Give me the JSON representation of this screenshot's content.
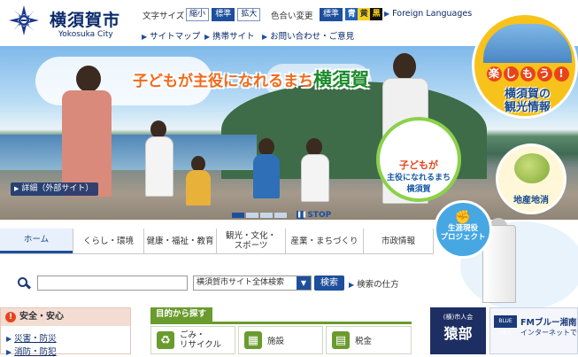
{
  "header": {
    "title_ja": "横須賀市",
    "title_en": "Yokosuka City",
    "font_size_label": "文字サイズ",
    "font_sizes": [
      "縮小",
      "標準",
      "拡大"
    ],
    "color_label": "色合い変更",
    "colors": [
      {
        "label": "標準",
        "bg": "#1e4f9c",
        "fg": "#ffffff"
      },
      {
        "label": "青",
        "bg": "#2060b8",
        "fg": "#ffffff"
      },
      {
        "label": "黄",
        "bg": "#f5d21b",
        "fg": "#333333"
      },
      {
        "label": "黒",
        "bg": "#111111",
        "fg": "#f5d21b"
      }
    ],
    "foreign_languages": "Foreign Languages",
    "links": [
      "サイトマップ",
      "携帯サイト",
      "お問い合わせ・ご意見"
    ]
  },
  "hero": {
    "caption_part1": "子どもが主役になれるまち",
    "caption_part2": "横須賀",
    "detail_link": "詳細（外部サイト）",
    "kids_badge_line1": "子どもが",
    "kids_badge_line2": "主役になれるまち",
    "kids_badge_line3": "横須賀",
    "tourism_badge_chars": [
      "楽",
      "し",
      "も",
      "う",
      "!"
    ],
    "tourism_badge_line1": "横須賀の",
    "tourism_badge_line2": "観光情報",
    "local_badge": "地産地消",
    "stop_label": "STOP"
  },
  "nav": {
    "items": [
      "ホーム",
      "くらし・環境",
      "健康・福祉・教育",
      "観光・文化・\nスポーツ",
      "産業・まちづくり",
      "市政情報"
    ]
  },
  "retire_badge": {
    "line1": "生涯現役",
    "line2": "プロジェクト"
  },
  "search": {
    "placeholder": "",
    "scope": "横須賀市サイト全体検索",
    "button": "検索",
    "help": "検索の仕方"
  },
  "safety": {
    "title": "安全・安心",
    "links": [
      "災害・防災",
      "消防・防犯"
    ]
  },
  "purpose": {
    "title": "目的から探す",
    "tiles": [
      {
        "label": "ごみ・\nリサイクル",
        "icon": "recycle-icon",
        "color": "#6a9b2e"
      },
      {
        "label": "施設",
        "icon": "building-icon",
        "color": "#6a9b2e"
      },
      {
        "label": "税金",
        "icon": "calculator-icon",
        "color": "#6a9b2e"
      }
    ]
  },
  "banners": {
    "b1_line1": "(横)市人会",
    "b1_line2": "猿部",
    "b2_logo": "BLUE 78.5",
    "b2_line1": "FMブルー湘南",
    "b2_line2": "インターネットで"
  }
}
